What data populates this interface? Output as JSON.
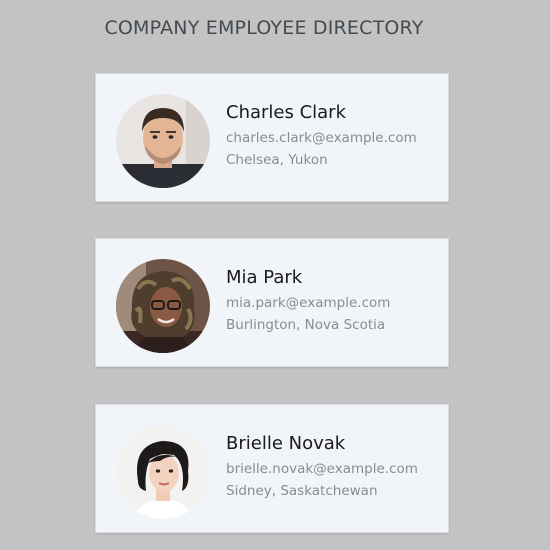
{
  "header": {
    "title": "COMPANY EMPLOYEE DIRECTORY"
  },
  "employees": [
    {
      "name": "Charles Clark",
      "email": "charles.clark@example.com",
      "location": "Chelsea, Yukon"
    },
    {
      "name": "Mia Park",
      "email": "mia.park@example.com",
      "location": "Burlington, Nova Scotia"
    },
    {
      "name": "Brielle Novak",
      "email": "brielle.novak@example.com",
      "location": "Sidney, Saskatchewan"
    }
  ],
  "colors": {
    "page_background": "#c3c3c3",
    "card_background": "#f1f4f8",
    "title_text": "#444a4f",
    "secondary_text": "#878d93"
  }
}
